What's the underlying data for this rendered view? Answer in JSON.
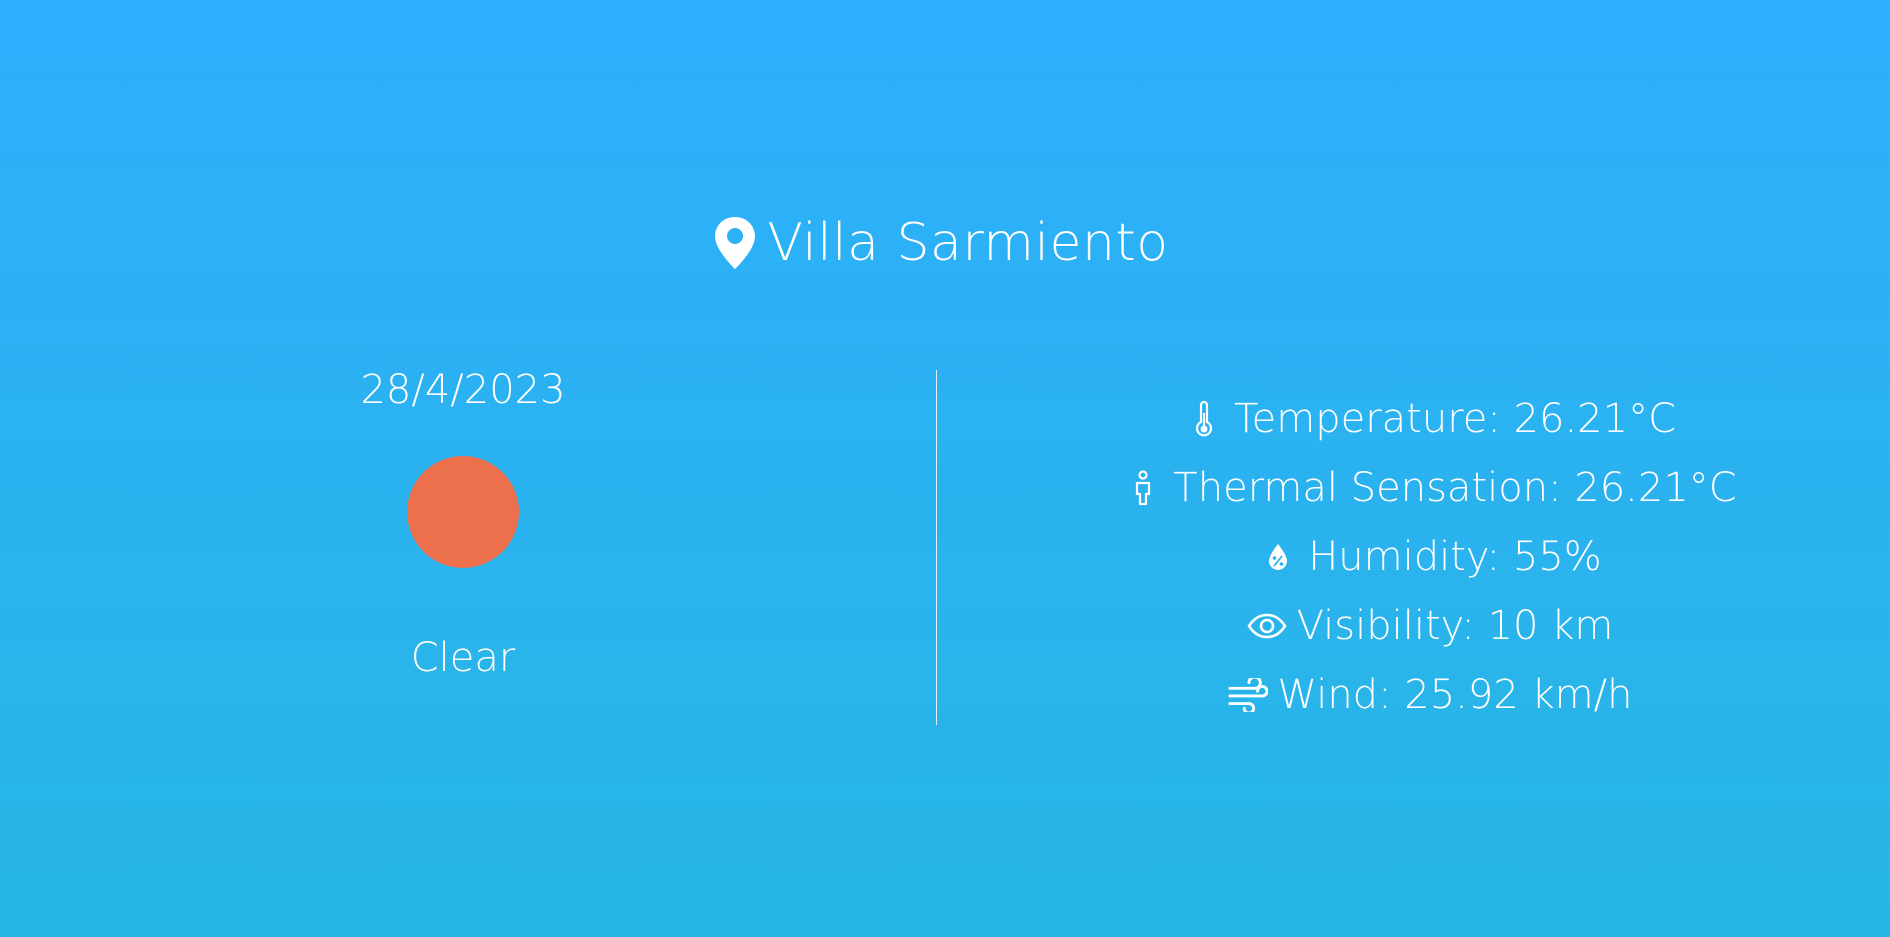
{
  "location": {
    "icon": "map-pin-icon",
    "city": "Villa Sarmiento"
  },
  "today": {
    "date": "28/4/2023",
    "condition": "Clear",
    "condition_icon": "sun-icon",
    "sun_color": "#ec704c"
  },
  "stats": [
    {
      "icon": "thermometer-icon",
      "text": "Temperature: 26.21°C"
    },
    {
      "icon": "person-icon",
      "text": "Thermal Sensation: 26.21°C"
    },
    {
      "icon": "humidity-drop-icon",
      "text": "Humidity: 55%"
    },
    {
      "icon": "eye-icon",
      "text": "Visibility: 10 km"
    },
    {
      "icon": "wind-icon",
      "text": "Wind: 25.92 km/h"
    }
  ],
  "colors": {
    "background_top": "#2eaefd",
    "background_bottom": "#27b6e3",
    "text": "#ffffff"
  }
}
